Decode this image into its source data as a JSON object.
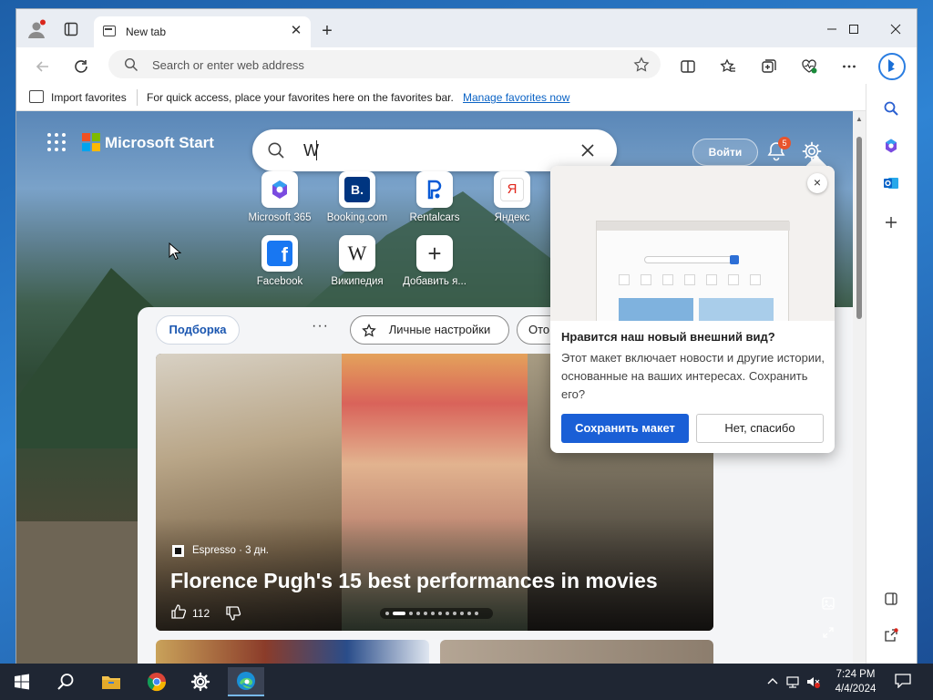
{
  "browser": {
    "tab_title": "New tab",
    "address_placeholder": "Search or enter web address",
    "favorites_bar": {
      "import_label": "Import favorites",
      "hint": "For quick access, place your favorites here on the favorites bar.",
      "manage_link": "Manage favorites now"
    }
  },
  "page": {
    "brand": "Microsoft Start",
    "search_value": "W",
    "login_label": "Войти",
    "notification_count": "5",
    "quick_links": [
      {
        "label": "Microsoft 365",
        "icon": "microsoft-365-icon"
      },
      {
        "label": "Booking.com",
        "icon": "booking-icon",
        "glyph": "B."
      },
      {
        "label": "Rentalcars",
        "icon": "rentalcars-icon"
      },
      {
        "label": "Яндекс",
        "icon": "yandex-icon",
        "glyph": "Я"
      },
      {
        "label": "Facebook",
        "icon": "facebook-icon",
        "glyph": "f"
      },
      {
        "label": "Википедия",
        "icon": "wikipedia-icon",
        "glyph": "W"
      },
      {
        "label": "Добавить я...",
        "icon": "add-icon",
        "glyph": "+"
      }
    ],
    "feed": {
      "tabs": [
        {
          "label": "Подборка",
          "active": true
        },
        {
          "label": "Личные настройки",
          "active": false
        },
        {
          "label": "Ото",
          "active": false
        }
      ],
      "more_label": "···",
      "hero": {
        "source": "Espresso · 3 дн.",
        "headline": "Florence Pugh's 15 best performances in movies",
        "likes": "112"
      }
    }
  },
  "popup": {
    "title": "Нравится наш новый внешний вид?",
    "body": "Этот макет включает новости и другие истории, основанные на ваших интересах. Сохранить его?",
    "keep_label": "Сохранить макет",
    "decline_label": "Нет, спасибо",
    "close_label": "×"
  },
  "taskbar": {
    "time": "7:24 PM",
    "date": "4/4/2024"
  },
  "colors": {
    "accent": "#1a5fd6",
    "link": "#0b63c5",
    "badge": "#e8542c",
    "taskbar": "#1f2633"
  }
}
